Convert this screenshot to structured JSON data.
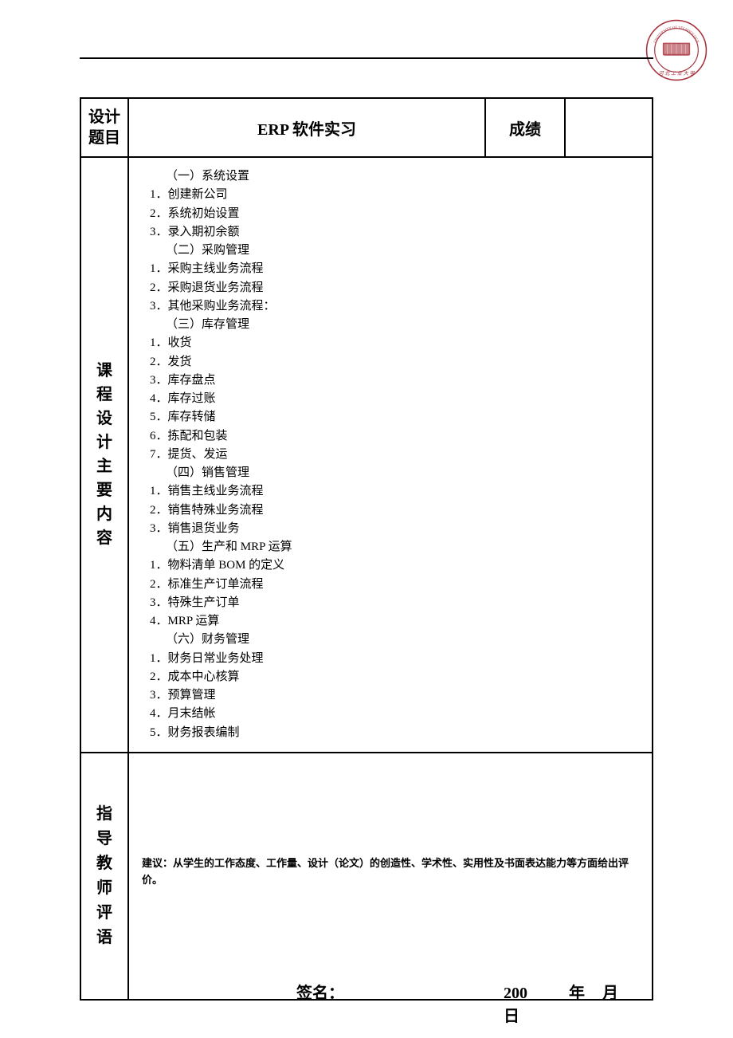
{
  "seal": {
    "outer_text_top": "UNIVERSITY OF TECHNOLOGY",
    "bottom_text": "河 北 工 业 大 学"
  },
  "header": {
    "design_topic_label_1": "设计",
    "design_topic_label_2": "题目",
    "title": "ERP 软件实习",
    "grade_label": "成绩",
    "grade_value": ""
  },
  "content": {
    "side_label": "课程设计主要内容",
    "sections": [
      "（一）系统设置",
      "1．创建新公司",
      "2．系统初始设置",
      "3．录入期初余额",
      "（二）采购管理",
      "1．采购主线业务流程",
      "2．采购退货业务流程",
      "3．其他采购业务流程：",
      "（三）库存管理",
      "1．收货",
      "2．发货",
      "3．库存盘点",
      "4．库存过账",
      "5．库存转储",
      "6．拣配和包装",
      "7．提货、发运",
      "（四）销售管理",
      "1．销售主线业务流程",
      "2．销售特殊业务流程",
      "3．销售退货业务",
      "（五）生产和 MRP 运算",
      "1．物料清单 BOM 的定义",
      "2．标准生产订单流程",
      "3．特殊生产订单",
      "4．MRP 运算",
      "（六）财务管理",
      "1．财务日常业务处理",
      "2．成本中心核算",
      "3．预算管理",
      "4．月末结帐",
      "5．财务报表编制"
    ]
  },
  "evaluation": {
    "side_label": "指导教师评语",
    "hint": "建议：从学生的工作态度、工作量、设计（论文）的创造性、学术性、实用性及书面表达能力等方面给出评价。",
    "sign_label": "签名：",
    "date_year_prefix": "200",
    "date_year_label": "年",
    "date_month_label": "月",
    "date_day_label": "日"
  }
}
